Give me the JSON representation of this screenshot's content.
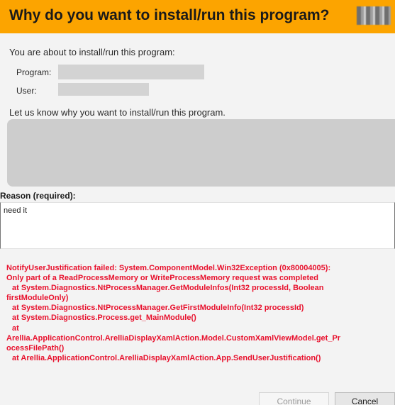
{
  "dialog": {
    "title": "Why do you want to install/run this program?",
    "intro": "You are about to install/run this program:",
    "program_label": "Program:",
    "user_label": "User:",
    "ask": "Let us know why you want to install/run this program.",
    "reason_label": "Reason (required):",
    "reason_value": "need it"
  },
  "error_lines": [
    "NotifyUserJustification failed: System.ComponentModel.Win32Exception (0x80004005):",
    "Only part of a ReadProcessMemory or WriteProcessMemory request was completed",
    "at System.Diagnostics.NtProcessManager.GetModuleInfos(Int32 processId, Boolean",
    "firstModuleOnly)",
    "at System.Diagnostics.NtProcessManager.GetFirstModuleInfo(Int32 processId)",
    "at System.Diagnostics.Process.get_MainModule()",
    "at",
    "Arellia.ApplicationControl.ArelliaDisplayXamlAction.Model.CustomXamlViewModel.get_Pr",
    "ocessFilePath()",
    "at Arellia.ApplicationControl.ArelliaDisplayXamlAction.App.SendUserJustification()"
  ],
  "buttons": {
    "continue": "Continue",
    "cancel": "Cancel"
  },
  "colors": {
    "titlebar": "#fca400",
    "error_text": "#e8112d"
  }
}
